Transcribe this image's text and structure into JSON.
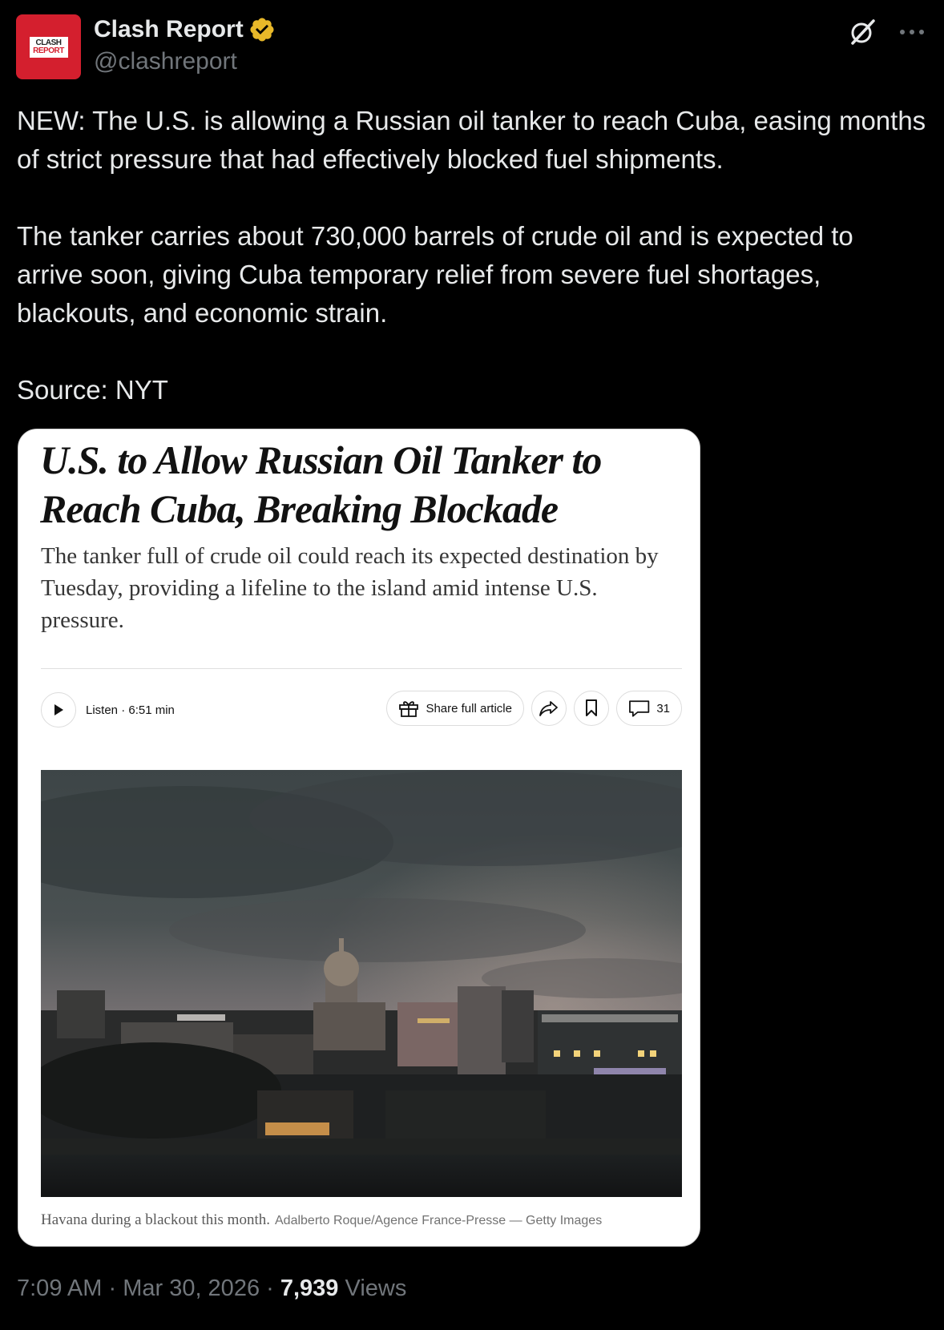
{
  "author": {
    "name": "Clash Report",
    "handle": "@clashreport",
    "avatar_line1": "CLASH",
    "avatar_line2": "REPORT",
    "verified_color": "#e8b829"
  },
  "tweet": {
    "text": "NEW: The U.S. is allowing a Russian oil tanker to reach Cuba, easing months of strict pressure that had effectively blocked fuel shipments.\n\nThe tanker carries about 730,000 barrels of crude oil and is expected to arrive soon, giving Cuba temporary relief from severe fuel shortages, blackouts, and economic strain.\n\nSource: NYT"
  },
  "card": {
    "headline": "U.S. to Allow Russian Oil Tanker to Reach Cuba, Breaking Blockade",
    "summary": "The tanker full of crude oil could reach its expected destination by Tuesday, providing a lifeline to the island amid intense U.S. pressure.",
    "listen_label": "Listen · 6:51 min",
    "share_label": "Share full article",
    "comments_count": "31",
    "caption": "Havana during a blackout this month.",
    "credit": "Adalberto Roque/Agence France-Presse — Getty Images"
  },
  "meta": {
    "time": "7:09 AM",
    "date": "Mar 30, 2026",
    "views_count": "7,939",
    "views_label": "Views"
  },
  "icons": {
    "verified": "verified-badge-icon",
    "grok": "grok-icon",
    "more": "more-options-icon",
    "play": "play-icon",
    "gift": "gift-icon",
    "share": "share-arrow-icon",
    "bookmark": "bookmark-icon",
    "comment": "comment-icon"
  }
}
